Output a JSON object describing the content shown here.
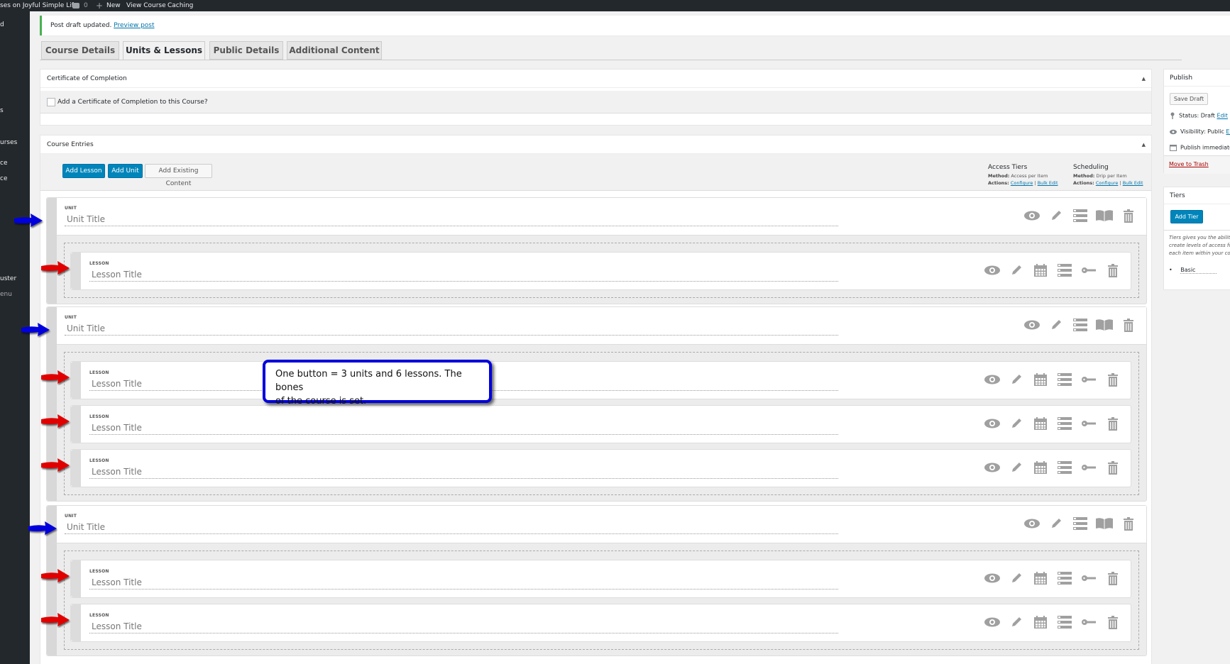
{
  "adminbar": {
    "site_name": "ses on Joyful Simple Life",
    "comments_count": "0",
    "new_label": "New",
    "view_course_label": "View Course",
    "caching_label": "Caching"
  },
  "sidebar": {
    "items": [
      {
        "label": "d"
      },
      {
        "label": "s"
      },
      {
        "label": "urses"
      },
      {
        "label": "ce"
      },
      {
        "label": "ce"
      },
      {
        "label": "uster"
      },
      {
        "label": "enu"
      }
    ]
  },
  "notice": {
    "text": "Post draft updated.",
    "link": "Preview post"
  },
  "tabs": [
    {
      "label": "Course Details",
      "active": false
    },
    {
      "label": "Units & Lessons",
      "active": true
    },
    {
      "label": "Public Details",
      "active": false
    },
    {
      "label": "Additional Content",
      "active": false
    }
  ],
  "certificate": {
    "title": "Certificate of Completion",
    "checkbox_label": "Add a Certificate of Completion to this Course?",
    "checked": false
  },
  "course_entries": {
    "title": "Course Entries",
    "buttons": {
      "add_lesson": "Add Lesson",
      "add_unit": "Add Unit",
      "add_existing": "Add Existing Content"
    },
    "access_tiers": {
      "title": "Access Tiers",
      "method_label": "Method:",
      "method_value": "Access per Item",
      "actions_label": "Actions:",
      "configure": "Configure",
      "bulk_edit": "Bulk Edit"
    },
    "scheduling": {
      "title": "Scheduling",
      "method_label": "Method:",
      "method_value": "Drip per Item",
      "actions_label": "Actions:",
      "configure": "Configure",
      "bulk_edit": "Bulk Edit"
    },
    "unit_type_label": "UNIT",
    "lesson_type_label": "LESSON",
    "units": [
      {
        "placeholder": "Unit Title",
        "lessons": [
          {
            "placeholder": "Lesson Title"
          }
        ]
      },
      {
        "placeholder": "Unit Title",
        "lessons": [
          {
            "placeholder": "Lesson Title"
          },
          {
            "placeholder": "Lesson Title"
          },
          {
            "placeholder": "Lesson Title"
          }
        ]
      },
      {
        "placeholder": "Unit Title",
        "lessons": [
          {
            "placeholder": "Lesson Title"
          },
          {
            "placeholder": "Lesson Title"
          }
        ]
      }
    ],
    "unit_icons": [
      "eye-icon",
      "pencil-icon",
      "numbered-list-icon",
      "book-icon",
      "trash-icon"
    ],
    "lesson_icons": [
      "eye-icon",
      "pencil-icon",
      "calendar-icon",
      "numbered-list-icon",
      "key-icon",
      "trash-icon"
    ]
  },
  "callout": {
    "line1": "One button = 3 units and 6 lessons. The bones",
    "line2": "of the course is set."
  },
  "publish": {
    "title": "Publish",
    "save_draft": "Save Draft",
    "status_label": "Status: Draft",
    "status_edit": "Edit",
    "visibility_label": "Visibility: Public",
    "visibility_edit": "Edit",
    "publish_label": "Publish immediately",
    "trash": "Move to Trash"
  },
  "tiers": {
    "title": "Tiers",
    "add_tier": "Add Tier",
    "description": "Tiers gives you the ability to create levels of access for each item within your course.",
    "items": [
      "Basic"
    ]
  },
  "colors": {
    "primary": "#0085ba",
    "unit_arrow": "#0000dd",
    "lesson_arrow": "#e00000",
    "notice_border": "#46b450"
  }
}
